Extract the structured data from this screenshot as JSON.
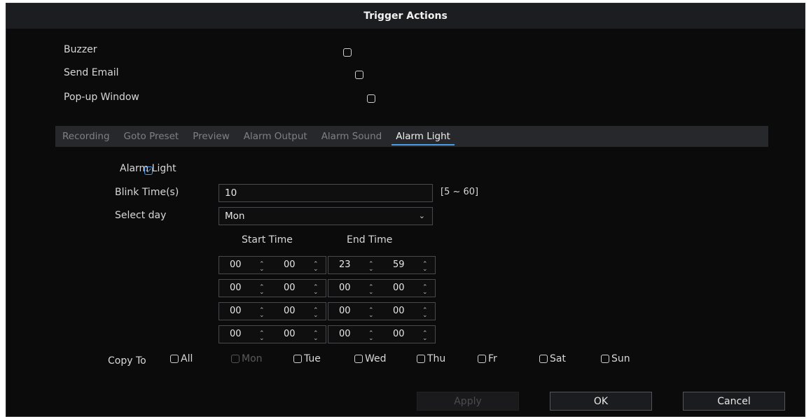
{
  "dialog": {
    "title": "Trigger Actions"
  },
  "actions": [
    {
      "label": "Buzzer",
      "checked": false
    },
    {
      "label": "Send Email",
      "checked": false
    },
    {
      "label": "Pop-up Window",
      "checked": false
    }
  ],
  "tabs": [
    "Recording",
    "Goto Preset",
    "Preview",
    "Alarm Output",
    "Alarm Sound",
    "Alarm Light"
  ],
  "active_tab": "Alarm Light",
  "alarm_light": {
    "enable_label": "Alarm Light",
    "enabled": true,
    "blink_time_label": "Blink Time(s)",
    "blink_time_value": "10",
    "blink_time_range": "[5 ~ 60]",
    "select_day_label": "Select day",
    "select_day_value": "Mon"
  },
  "schedule": {
    "start_label": "Start Time",
    "end_label": "End Time",
    "rows": [
      {
        "start_h": "00",
        "start_m": "00",
        "end_h": "23",
        "end_m": "59"
      },
      {
        "start_h": "00",
        "start_m": "00",
        "end_h": "00",
        "end_m": "00"
      },
      {
        "start_h": "00",
        "start_m": "00",
        "end_h": "00",
        "end_m": "00"
      },
      {
        "start_h": "00",
        "start_m": "00",
        "end_h": "00",
        "end_m": "00"
      }
    ]
  },
  "copy_to": {
    "label": "Copy To",
    "days": [
      {
        "label": "All",
        "checked": false,
        "disabled": false
      },
      {
        "label": "Mon",
        "checked": false,
        "disabled": true
      },
      {
        "label": "Tue",
        "checked": false,
        "disabled": false
      },
      {
        "label": "Wed",
        "checked": false,
        "disabled": false
      },
      {
        "label": "Thu",
        "checked": false,
        "disabled": false
      },
      {
        "label": "Fr",
        "checked": false,
        "disabled": false
      },
      {
        "label": "Sat",
        "checked": false,
        "disabled": false
      },
      {
        "label": "Sun",
        "checked": false,
        "disabled": false
      }
    ]
  },
  "buttons": {
    "apply": "Apply",
    "ok": "OK",
    "cancel": "Cancel"
  },
  "icons": {
    "checkbox": "checkbox-icon",
    "dropdown": "chevron-down-icon",
    "spinner": "spinner-updown-icon"
  },
  "colors": {
    "accent": "#4a9be8",
    "background": "#0b0b0c",
    "titlebar": "#1c1d20"
  }
}
